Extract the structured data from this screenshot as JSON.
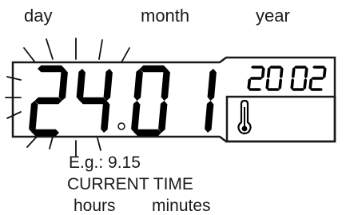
{
  "labels": {
    "day": "day",
    "month": "month",
    "year": "year",
    "example": "E.g.: 9.15",
    "current_time": "CURRENT TIME",
    "hours": "hours",
    "minutes": "minutes"
  },
  "display": {
    "day_digits": "24",
    "month_digits": "01",
    "year_digits": "2002",
    "icon": "thermometer-icon",
    "segment_color": "#000000",
    "frame_color": "#1a1a1a"
  }
}
